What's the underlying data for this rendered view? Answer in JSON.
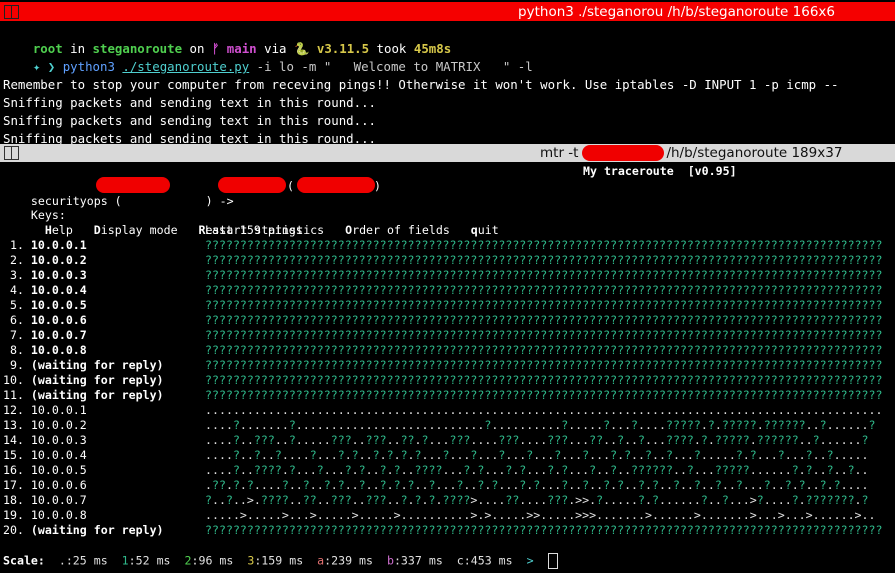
{
  "top_pane": {
    "title": "python3 ./steganorou /h/b/steganoroute 166x6",
    "prompt": {
      "user": "root",
      "in": " in ",
      "dir": "steganoroute",
      "on": " on ",
      "branch_icon": "ᚠ",
      "branch": " main",
      "via": " via ",
      "python_icon": "🐍",
      "python_version": " v3.11.5",
      "took": " took ",
      "duration": "45m8s",
      "symbol": "✦ ❯",
      "cmd": "python3",
      "script": "./steganoroute.py",
      "args": " -i lo -m \"   Welcome to MATRIX   \" -l"
    },
    "output": [
      "Remember to stop your computer from receving pings!! Otherwise it won't work. Use iptables -D INPUT 1 -p icmp --",
      "Sniffing packets and sending text in this round...",
      "Sniffing packets and sending text in this round...",
      "Sniffing packets and sending text in this round..."
    ]
  },
  "bottom_pane": {
    "title_prefix": "mtr -t",
    "title_suffix": "/h/b/steganoroute 189x37",
    "header": "My traceroute  [v0.95]",
    "host_from": "securityops (",
    "arrow": ") -> ",
    "keys_label": "Keys:",
    "keys": [
      {
        "key": "H",
        "rest": "elp"
      },
      {
        "key": "D",
        "rest": "isplay mode"
      },
      {
        "key": "R",
        "rest": "estart statistics"
      },
      {
        "key": "O",
        "rest": "rder of fields"
      },
      {
        "key": "q",
        "rest": "uit"
      }
    ],
    "pings_label": "Last 159 pings",
    "hops": [
      {
        "n": "1.",
        "addr": "10.0.0.1",
        "bold": true,
        "data": "?????????????????????????????????????????????????????????????????????????????????????????????????"
      },
      {
        "n": "2.",
        "addr": "10.0.0.2",
        "bold": true,
        "data": "?????????????????????????????????????????????????????????????????????????????????????????????????"
      },
      {
        "n": "3.",
        "addr": "10.0.0.3",
        "bold": true,
        "data": "?????????????????????????????????????????????????????????????????????????????????????????????????"
      },
      {
        "n": "4.",
        "addr": "10.0.0.4",
        "bold": true,
        "data": "?????????????????????????????????????????????????????????????????????????????????????????????????"
      },
      {
        "n": "5.",
        "addr": "10.0.0.5",
        "bold": true,
        "data": "?????????????????????????????????????????????????????????????????????????????????????????????????"
      },
      {
        "n": "6.",
        "addr": "10.0.0.6",
        "bold": true,
        "data": "?????????????????????????????????????????????????????????????????????????????????????????????????"
      },
      {
        "n": "7.",
        "addr": "10.0.0.7",
        "bold": true,
        "data": "?????????????????????????????????????????????????????????????????????????????????????????????????"
      },
      {
        "n": "8.",
        "addr": "10.0.0.8",
        "bold": true,
        "data": "?????????????????????????????????????????????????????????????????????????????????????????????????"
      },
      {
        "n": "9.",
        "addr": "(waiting for reply)",
        "bold": true,
        "data": "?????????????????????????????????????????????????????????????????????????????????????????????????"
      },
      {
        "n": "10.",
        "addr": "(waiting for reply)",
        "bold": true,
        "data": "?????????????????????????????????????????????????????????????????????????????????????????????????"
      },
      {
        "n": "11.",
        "addr": "(waiting for reply)",
        "bold": true,
        "data": "?????????????????????????????????????????????????????????????????????????????????????????????????"
      },
      {
        "n": "12.",
        "addr": "10.0.0.1",
        "bold": false,
        "data": "................................................................................................."
      },
      {
        "n": "13.",
        "addr": "10.0.0.2",
        "bold": false,
        "data": "....?.......?...........................?..........?.....?...?....?????.?.?????.??????..?......?"
      },
      {
        "n": "14.",
        "addr": "10.0.0.3",
        "bold": false,
        "data": "....?..???..?.....???..???..??.?...???....???....???...??..?..?...????.?.?????.??????..?......?"
      },
      {
        "n": "15.",
        "addr": "10.0.0.4",
        "bold": false,
        "data": "....?..?..?....?...?.?..?.?.?.?...?...?...?...?...?...?...?.?..?..?...?.....?.?...?...?..?....."
      },
      {
        "n": "16.",
        "addr": "10.0.0.5",
        "bold": false,
        "data": "....?..????.?...?...?.?..?.?..????...?.?...?.?...?.?...?..?..??????..?...?????......?.?..?..?.."
      },
      {
        "n": "17.",
        "addr": "10.0.0.6",
        "bold": false,
        "data": ".??.?.?....?..?..?.?..?..?.?.?..?...?..?.?...?.?...?..?..?.?..?.?..?..?..?..?...?..?.?..?.?...."
      },
      {
        "n": "18.",
        "addr": "10.0.0.7",
        "bold": false,
        "data": "?..?..>.????..??..???..???..?.?.?.????>....??....???.>>.?.....?.?......?..?...>?....?.???????.?"
      },
      {
        "n": "19.",
        "addr": "10.0.0.8",
        "bold": false,
        "data": ".....>.....>...>.....>.....>..........>.>.....>>.....>>>.......>......>.......>...>...>......>.."
      },
      {
        "n": "20.",
        "addr": "(waiting for reply)",
        "bold": true,
        "data": "?????????????????????????????????????????????????????????????????????????????????????????????????"
      }
    ],
    "scale": {
      "label": "Scale:",
      "items": [
        {
          "sym": ".",
          "val": ":25 ms",
          "color": "#e0e0e0"
        },
        {
          "sym": "1",
          "val": ":52 ms",
          "color": "#2fb88a"
        },
        {
          "sym": "2",
          "val": ":96 ms",
          "color": "#4fcf4f"
        },
        {
          "sym": "3",
          "val": ":159 ms",
          "color": "#d7c84a"
        },
        {
          "sym": "a",
          "val": ":239 ms",
          "color": "#e07070"
        },
        {
          "sym": "b",
          "val": ":337 ms",
          "color": "#d070d0"
        },
        {
          "sym": "c",
          "val": ":453 ms",
          "color": "#e0e0e0"
        },
        {
          "sym": ">",
          "val": "",
          "color": "#4fd0d0"
        }
      ]
    }
  },
  "colors": {
    "top_titlebar": "#f50000",
    "bottom_titlebar": "#d9d9d9",
    "redaction": "#f00000",
    "question": "#2fb88a"
  }
}
